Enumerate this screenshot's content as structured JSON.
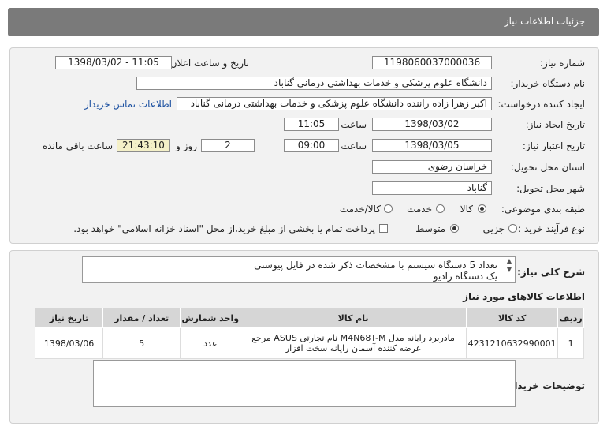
{
  "header": {
    "title": "جزئیات اطلاعات نیاز"
  },
  "form": {
    "need_number_label": "شماره نیاز:",
    "need_number": "1198060037000036",
    "announce_label": "تاریخ و ساعت اعلان عمومی:",
    "announce_value": "1398/03/02 - 11:05",
    "buyer_org_label": "نام دستگاه خریدار:",
    "buyer_org": "دانشگاه علوم پزشکی و خدمات بهداشتی درمانی گناباد",
    "creator_label": "ایجاد کننده درخواست:",
    "creator": "اکبر زهرا زاده راننده دانشگاه علوم پزشکی و خدمات بهداشتی درمانی گناباد",
    "contact_link": "اطلاعات تماس خریدار",
    "created_date_label": "تاریخ ایجاد نیاز:",
    "created_date": "1398/03/02",
    "time_label": "ساعت",
    "created_time": "11:05",
    "valid_date_label": "تاریخ اعتبار نیاز:",
    "valid_date": "1398/03/05",
    "valid_time": "09:00",
    "days": "2",
    "days_label": "روز و",
    "remaining": "21:43:10",
    "remaining_label": "ساعت باقی مانده",
    "province_label": "استان محل تحویل:",
    "province": "خراسان رضوی",
    "city_label": "شهر محل تحویل:",
    "city": "گناباد",
    "category_label": "طبقه بندی موضوعی:",
    "category_options": [
      "کالا",
      "خدمت",
      "کالا/خدمت"
    ],
    "category_selected": "کالا",
    "process_label": "نوع فرآیند خرید :",
    "process_options": [
      "جزیی",
      "متوسط"
    ],
    "process_selected": "متوسط",
    "payment_note": "پرداخت تمام یا بخشی از مبلغ خرید،از محل \"اسناد خزانه اسلامی\" خواهد بود."
  },
  "description": {
    "label": "شرح کلی نیاز:",
    "line1": "تعداد 5 دستگاه سیستم با مشخصات ذکر شده در فایل پیوستی",
    "line2": "یک دستگاه رادیو"
  },
  "goods": {
    "title": "اطلاعات کالاهای مورد نیاز",
    "columns": [
      "ردیف",
      "کد کالا",
      "نام کالا",
      "واحد شمارش",
      "تعداد / مقدار",
      "تاریخ نیاز"
    ],
    "rows": [
      {
        "row": "1",
        "code": "4231210632990001",
        "name": "مادربرد رایانه مدل M4N68T-M نام تجارتی ASUS مرجع عرضه کننده آسمان رایانه سخت افزار",
        "unit": "عدد",
        "qty": "5",
        "date": "1398/03/06"
      }
    ]
  },
  "buyer_notes": {
    "label": "توضیحات خریدار:",
    "value": ""
  }
}
